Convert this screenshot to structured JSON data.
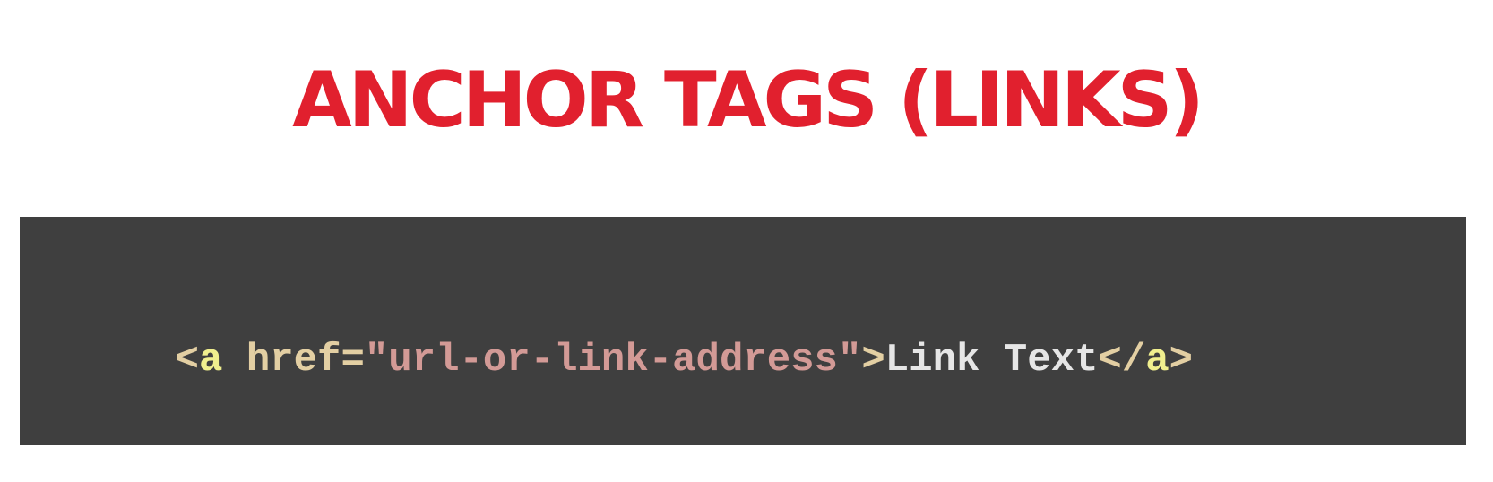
{
  "title": "ANCHOR TAGS (LINKS)",
  "code": {
    "tokens": [
      {
        "text": "<",
        "color": "#e3cfa3"
      },
      {
        "text": "a",
        "color": "#f0ef8e"
      },
      {
        "text": " href=",
        "color": "#e3cfa3"
      },
      {
        "text": "\"url-or-link-address\"",
        "color": "#d39a96"
      },
      {
        "text": ">",
        "color": "#e3cfa3"
      },
      {
        "text": "Link Text",
        "color": "#e6e6e6"
      },
      {
        "text": "</",
        "color": "#e3cfa3"
      },
      {
        "text": "a",
        "color": "#f0ef8e"
      },
      {
        "text": ">",
        "color": "#e3cfa3"
      }
    ]
  },
  "colors": {
    "title": "#e1202e",
    "code_background": "#3f3f3f"
  }
}
